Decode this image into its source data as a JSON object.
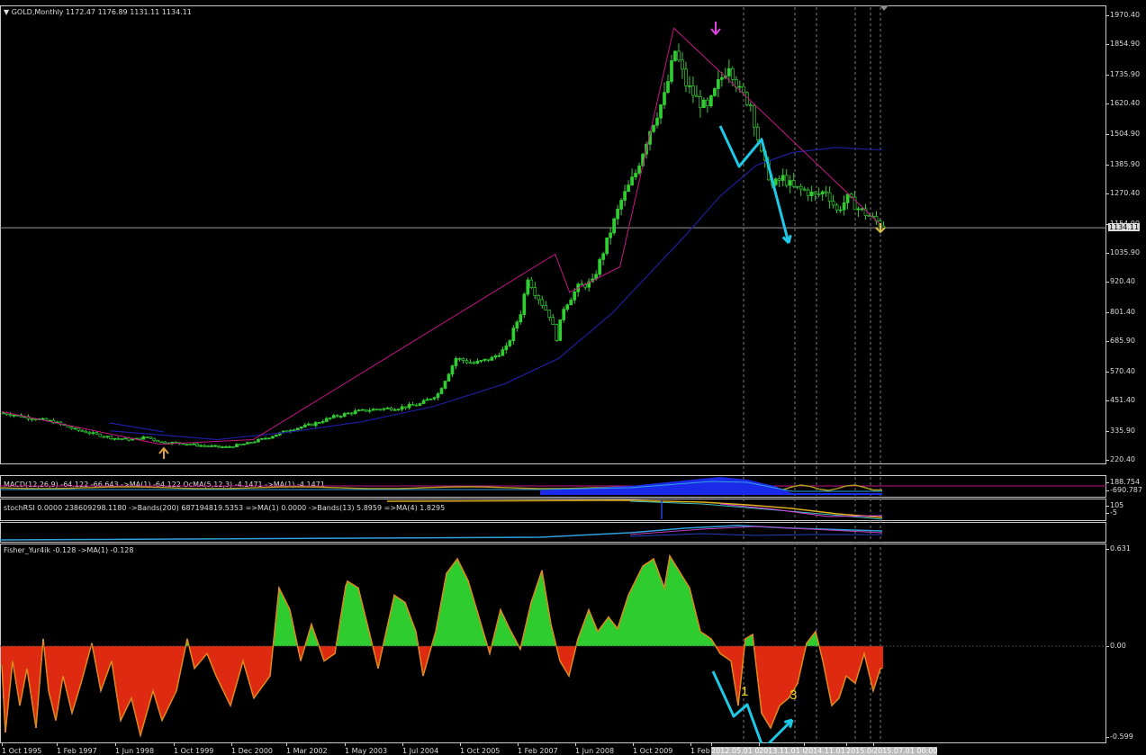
{
  "main_chart": {
    "title": "GOLD,Monthly",
    "ohlc": "1172.47 1176.89 1131.11 1134.11",
    "last_price": "1134.11",
    "price_ticks": [
      "1970.40",
      "1854.90",
      "1735.90",
      "1620.40",
      "1504.90",
      "1385.90",
      "1270.40",
      "1154.90",
      "1035.90",
      "920.40",
      "801.40",
      "685.90",
      "570.40",
      "451.40",
      "335.90",
      "220.40"
    ],
    "colors": {
      "up_candle": "#32cd32",
      "down_candle": "#32cd32",
      "moving_average": "#1e1e9c",
      "zigzag": "#c71585",
      "annotation_arrow": "#1ec8e6"
    }
  },
  "macd_pane": {
    "label": "MACD(12,26,9) -64.122 -66.643 ->MA(1) -64.122 OcMA(5,12,3) -4.1471 ->MA(1) -4.1471",
    "ticks": [
      "188.754",
      "-690.787"
    ]
  },
  "stoch_pane": {
    "label": "stochRSI 0.0000 238609298.1180 ->Bands(200) 687194819.5353 =>MA(1) 0.0000 ->Bands(13) 5.8959 =>MA(4) 1.8295",
    "ticks": [
      "105",
      "-5"
    ]
  },
  "fisher_pane": {
    "label": "Fisher_Yur4ik -0.128 ->MA(1) -0.128",
    "ticks": [
      "0.631",
      "0.00",
      "-0.599"
    ],
    "wave_labels": [
      "1",
      "3"
    ],
    "colors": {
      "positive": "#2ecc2e",
      "negative": "#dd2a10",
      "outline": "#e08a1e"
    }
  },
  "time_axis": {
    "labels": [
      "1 Oct 1995",
      "1 Feb 1997",
      "1 Jun 1998",
      "1 Oct 1999",
      "1 Dec 2000",
      "1 Mar 2002",
      "1 May 2003",
      "1 Jul 2004",
      "1 Oct 2005",
      "1 Feb 2007",
      "1 Jun 2008",
      "1 Oct 2009",
      "1 Feb"
    ],
    "highlight_labels": [
      "2012.05.01 00:00",
      "2013.11.01 00:00",
      "2014.11.01 00:00",
      "2015.04.01 00:00",
      "2015.07.01 00:00"
    ]
  }
}
